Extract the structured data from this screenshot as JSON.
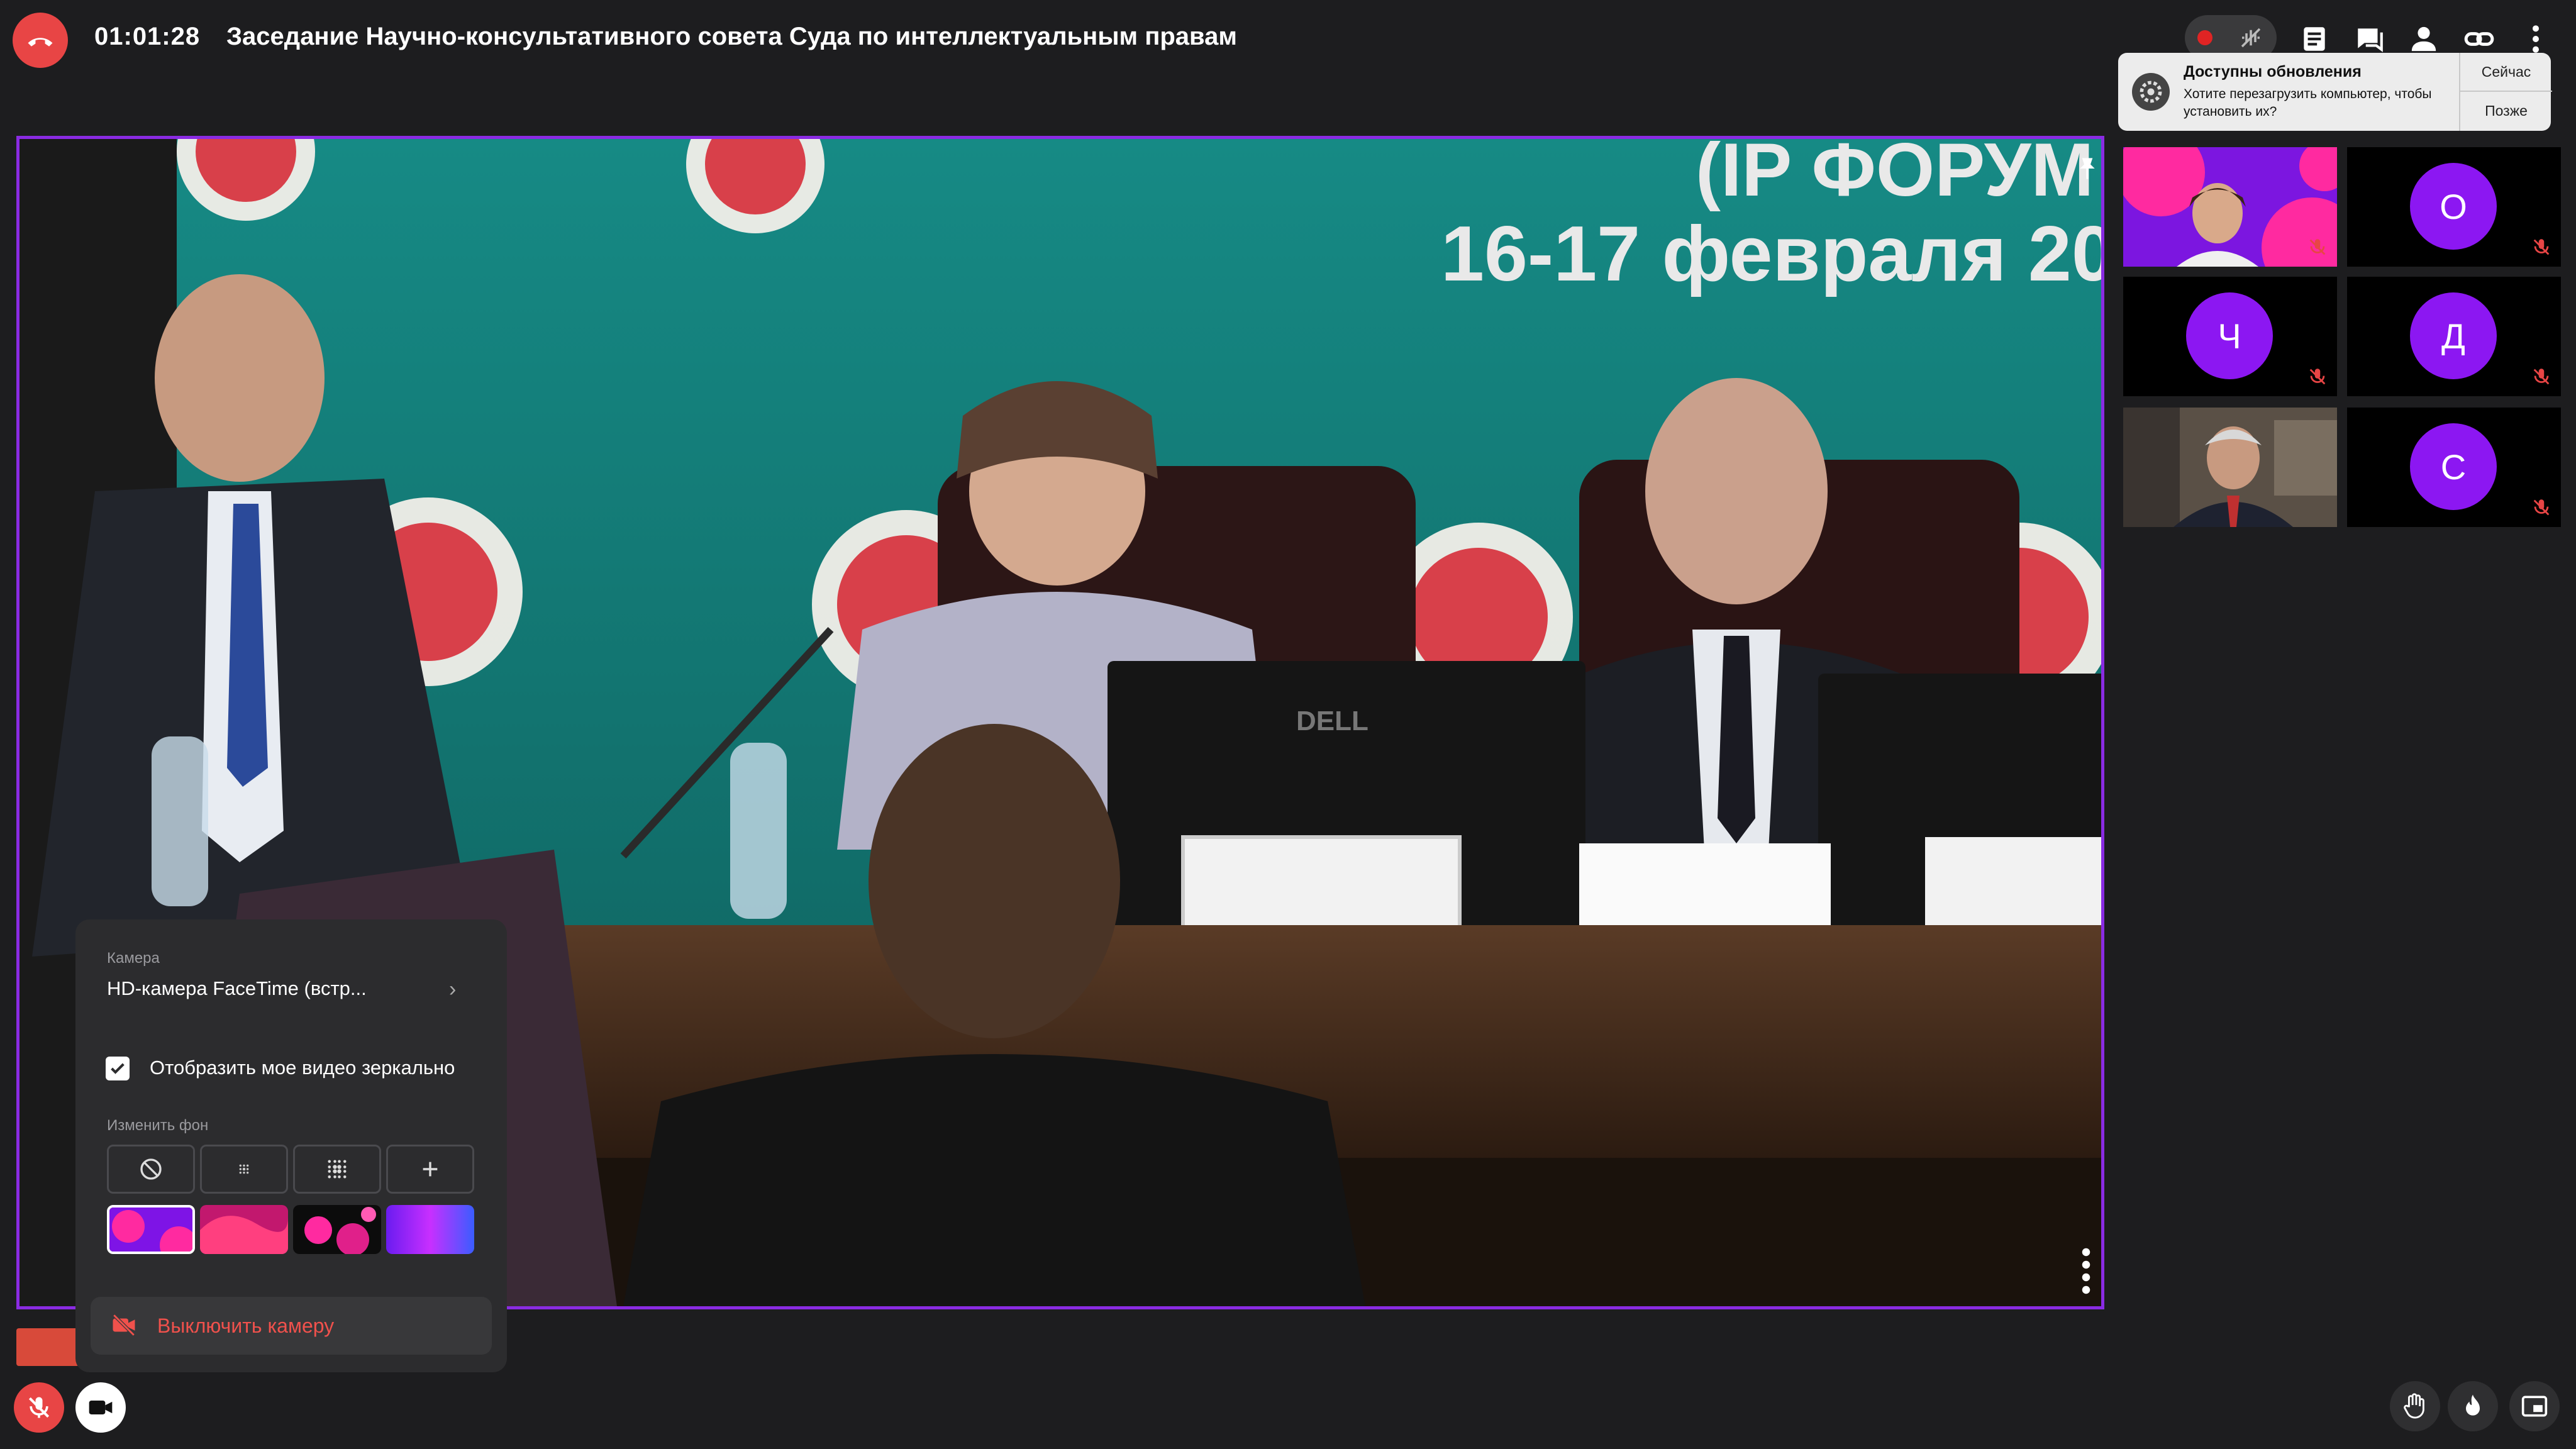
{
  "header": {
    "timer": "01:01:28",
    "title": "Заседание Научно-консультативного совета Суда по интеллектуальным правам"
  },
  "toolbar_icons": [
    "end-call-icon",
    "record-icon",
    "audio-waves-icon",
    "document-icon",
    "chat-icon",
    "participants-icon",
    "link-icon",
    "more-icon"
  ],
  "notification": {
    "title": "Доступны обновления",
    "message": "Хотите перезагрузить компьютер, чтобы установить их?",
    "now_label": "Сейчас",
    "later_label": "Позже"
  },
  "main_video": {
    "banner_line1": "(IP ФОРУМ",
    "banner_line2": "16-17 февраля 20",
    "monitor_brand": "DELL"
  },
  "participants": [
    {
      "type": "video"
    },
    {
      "type": "avatar",
      "initial": "О"
    },
    {
      "type": "avatar",
      "initial": "Ч"
    },
    {
      "type": "avatar",
      "initial": "Д"
    },
    {
      "type": "video"
    },
    {
      "type": "avatar",
      "initial": "С"
    }
  ],
  "camera_popup": {
    "camera_label": "Камера",
    "camera_value": "HD-камера FaceTime (встр...",
    "mirror_label": "Отобразить мое видео зеркально",
    "mirror_checked": true,
    "background_label": "Изменить фон",
    "turn_off_label": "Выключить камеру"
  },
  "colors": {
    "accent": "#8a2be2",
    "avatar_bg": "#8c17f2",
    "end_call": "#e84545",
    "danger_text": "#f0514c"
  }
}
